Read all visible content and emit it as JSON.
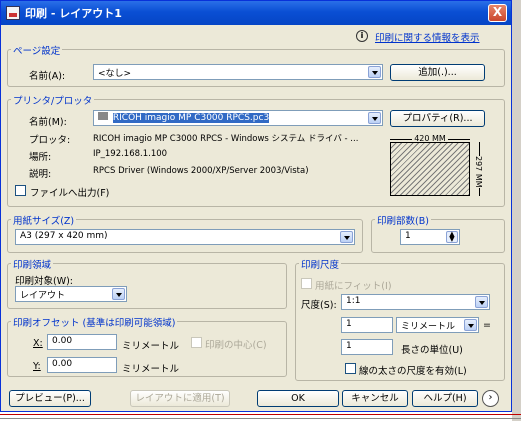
{
  "window": {
    "title": "印刷 - レイアウト1",
    "close_label": "X"
  },
  "help_link": "印刷に関する情報を表示",
  "info_icon": "i",
  "page_setup": {
    "group_label": "ページ設定",
    "name_label": "名前(A):",
    "name_value": "<なし>",
    "add_button": "追加(.)..."
  },
  "printer": {
    "group_label": "プリンタ/プロッタ",
    "name_label": "名前(M):",
    "name_value": "RICOH imagio MP C3000 RPCS.pc3",
    "properties_button": "プロパティ(R)...",
    "plotter_label": "プロッタ:",
    "plotter_value": "RICOH imagio MP C3000 RPCS - Windows システム ドライバ - ...",
    "location_label": "場所:",
    "location_value": "IP_192.168.1.100",
    "description_label": "説明:",
    "description_value": "RPCS Driver (Windows 2000/XP/Server 2003/Vista)",
    "print_to_file_label": "ファイルへ出力(F)",
    "paper_width_label": "420 MM",
    "paper_height_label": "297 MM"
  },
  "paper_size": {
    "group_label": "用紙サイズ(Z)",
    "value": "A3 (297 x 420 mm)"
  },
  "copies": {
    "group_label": "印刷部数(B)",
    "value": "1"
  },
  "plot_area": {
    "group_label": "印刷領域",
    "what_label": "印刷対象(W):",
    "what_value": "レイアウト"
  },
  "plot_scale": {
    "group_label": "印刷尺度",
    "fit_label": "用紙にフィット(I)",
    "scale_label": "尺度(S):",
    "scale_value": "1:1",
    "value1": "1",
    "unit_value": "ミリメートル",
    "equals": "=",
    "value2": "1",
    "unit2_label": "長さの単位(U)",
    "lineweight_label": "線の太さの尺度を有効(L)"
  },
  "offset": {
    "group_label": "印刷オフセット (基準は印刷可能領域)",
    "x_label": "X:",
    "x_value": "0.00",
    "x_unit": "ミリメートル",
    "center_label": "印刷の中心(C)",
    "y_label": "Y:",
    "y_value": "0.00",
    "y_unit": "ミリメートル"
  },
  "buttons": {
    "preview": "プレビュー(P)...",
    "apply_layout": "レイアウトに適用(T)",
    "ok": "OK",
    "cancel": "キャンセル",
    "help": "ヘルプ(H)",
    "more": "›"
  }
}
